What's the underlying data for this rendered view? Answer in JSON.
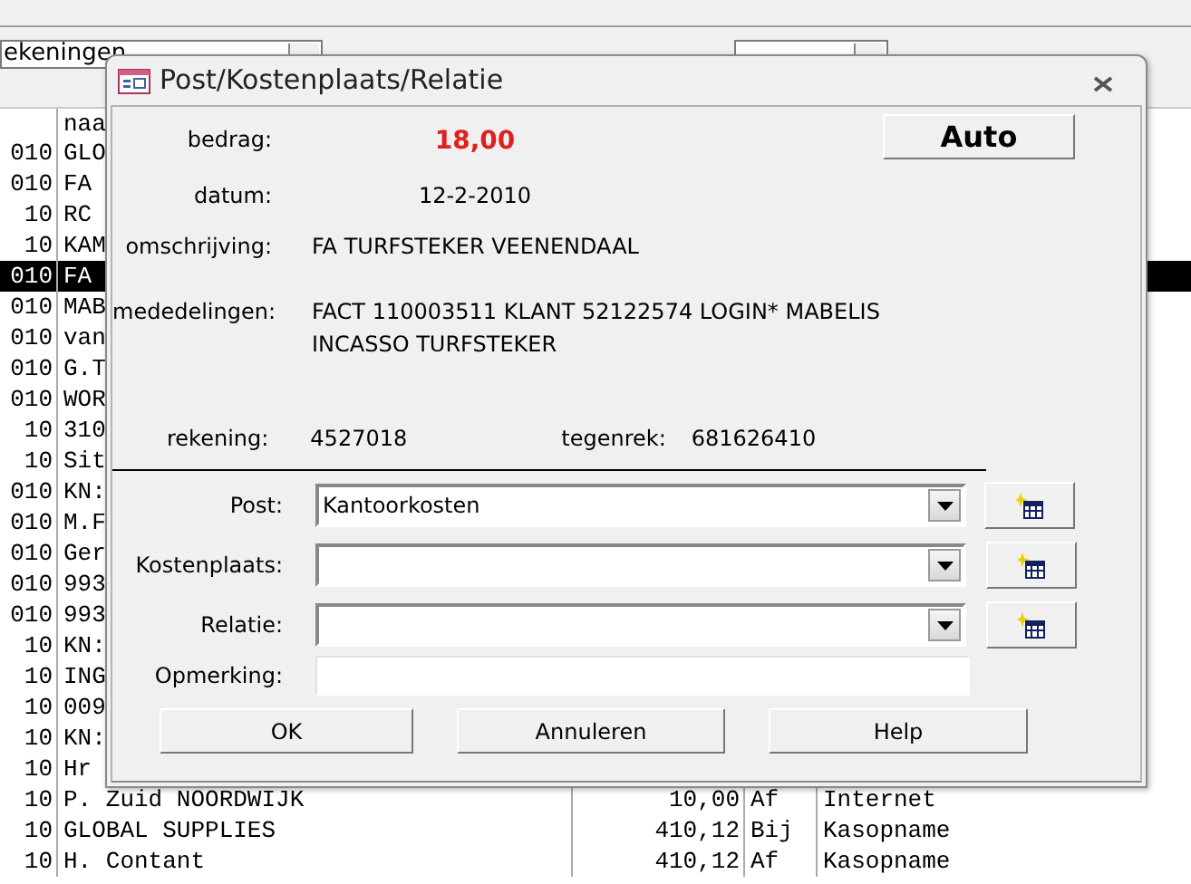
{
  "filter_combo": {
    "value": "ekeningen"
  },
  "grid": {
    "header": "naa",
    "rows": [
      {
        "column_1": "010",
        "column_2": "GLO",
        "selected": false
      },
      {
        "column_1": "010",
        "column_2": "FA",
        "selected": false
      },
      {
        "column_1": "10",
        "column_2": "RC",
        "selected": false
      },
      {
        "column_1": "10",
        "column_2": "KAM",
        "selected": false
      },
      {
        "column_1": "010",
        "column_2": "FA",
        "selected": true
      },
      {
        "column_1": "010",
        "column_2": "MAB",
        "selected": false
      },
      {
        "column_1": "010",
        "column_2": "van",
        "selected": false
      },
      {
        "column_1": "010",
        "column_2": "G.T",
        "selected": false
      },
      {
        "column_1": "010",
        "column_2": "WOR",
        "selected": false
      },
      {
        "column_1": "10",
        "column_2": "310",
        "selected": false
      },
      {
        "column_1": "10",
        "column_2": "Sit",
        "selected": false
      },
      {
        "column_1": "010",
        "column_2": "KN:",
        "selected": false
      },
      {
        "column_1": "010",
        "column_2": "M.F",
        "selected": false
      },
      {
        "column_1": "010",
        "column_2": "Ger",
        "selected": false
      },
      {
        "column_1": "010",
        "column_2": "993",
        "selected": false
      },
      {
        "column_1": "010",
        "column_2": "993",
        "selected": false
      },
      {
        "column_1": "10",
        "column_2": "KN:",
        "selected": false
      },
      {
        "column_1": "10",
        "column_2": "ING",
        "selected": false
      },
      {
        "column_1": "10",
        "column_2": "009",
        "selected": false
      },
      {
        "column_1": "10",
        "column_2": "KN:",
        "selected": false
      },
      {
        "column_1": "10",
        "column_2": "Hr",
        "selected": false
      },
      {
        "column_1": "10",
        "column_2": "P. Zuid NOORDWIJK",
        "column_3": "10,00",
        "column_4": "Af",
        "column_5": "Internet",
        "selected": false
      },
      {
        "column_1": "10",
        "column_2": "GLOBAL SUPPLIES",
        "column_3": "410,12",
        "column_4": "Bij",
        "column_5": "Kasopname",
        "selected": false
      },
      {
        "column_1": "10",
        "column_2": "H. Contant",
        "column_3": "410,12",
        "column_4": "Af",
        "column_5": "Kasopname",
        "selected": false
      }
    ]
  },
  "dialog": {
    "title": "Post/Kostenplaats/Relatie",
    "info": [
      {
        "label": "bedrag:",
        "value": "18,00",
        "kind": "amount"
      },
      {
        "label": "datum:",
        "value": "12-2-2010",
        "kind": "date"
      },
      {
        "label": "omschrijving:",
        "value": "FA TURFSTEKER VEENENDAAL",
        "kind": "text"
      },
      {
        "label": "mededelingen:",
        "value": "FACT 110003511 KLANT 52122574 LOGIN* MABELIS",
        "value_2": "INCASSO TURFSTEKER",
        "kind": "memo"
      }
    ],
    "auto_button": "Auto",
    "rekening_label": "rekening:",
    "rekening": "4527018",
    "tegenrek_label": "tegenrek:",
    "tegenrek": "681626410",
    "fields": [
      {
        "label": "Post:",
        "kind": "combo",
        "value": "Kantoorkosten"
      },
      {
        "label": "Kostenplaats:",
        "kind": "combo"
      },
      {
        "label": "Relatie:",
        "kind": "combo"
      },
      {
        "label": "Opmerking:",
        "kind": "text"
      }
    ],
    "buttons": [
      "OK",
      "Annuleren",
      "Help"
    ]
  }
}
